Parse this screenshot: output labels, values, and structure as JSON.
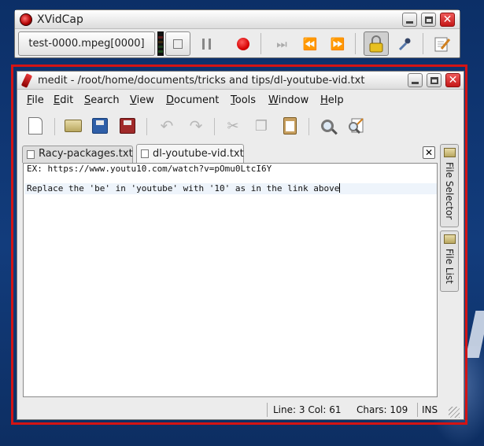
{
  "xvidcap": {
    "title": "XVidCap",
    "file_label": "test-0000.mpeg[0000]",
    "colors": {
      "record": "#d40000",
      "close": "#d42020"
    }
  },
  "medit": {
    "title": "medit - /root/home/documents/tricks and tips/dl-youtube-vid.txt",
    "menu": [
      {
        "mnemonic": "F",
        "rest": "ile"
      },
      {
        "mnemonic": "E",
        "rest": "dit"
      },
      {
        "mnemonic": "S",
        "rest": "earch"
      },
      {
        "mnemonic": "V",
        "rest": "iew"
      },
      {
        "mnemonic": "D",
        "rest": "ocument"
      },
      {
        "mnemonic": "T",
        "rest": "ools"
      },
      {
        "mnemonic": "W",
        "rest": "indow"
      },
      {
        "mnemonic": "H",
        "rest": "elp"
      }
    ],
    "tabs": [
      {
        "label": "Racy-packages.txt",
        "active": false
      },
      {
        "label": "dl-youtube-vid.txt",
        "active": true
      }
    ],
    "editor_lines": [
      "EX: https://www.youtu10.com/watch?v=pOmu0LtcI6Y",
      "",
      "Replace the 'be' in 'youtube' with '10' as in the link above"
    ],
    "side_tabs": [
      "File Selector",
      "File List"
    ],
    "status": {
      "position": "Line: 3 Col: 61",
      "chars": "Chars: 109",
      "mode": "INS"
    }
  }
}
